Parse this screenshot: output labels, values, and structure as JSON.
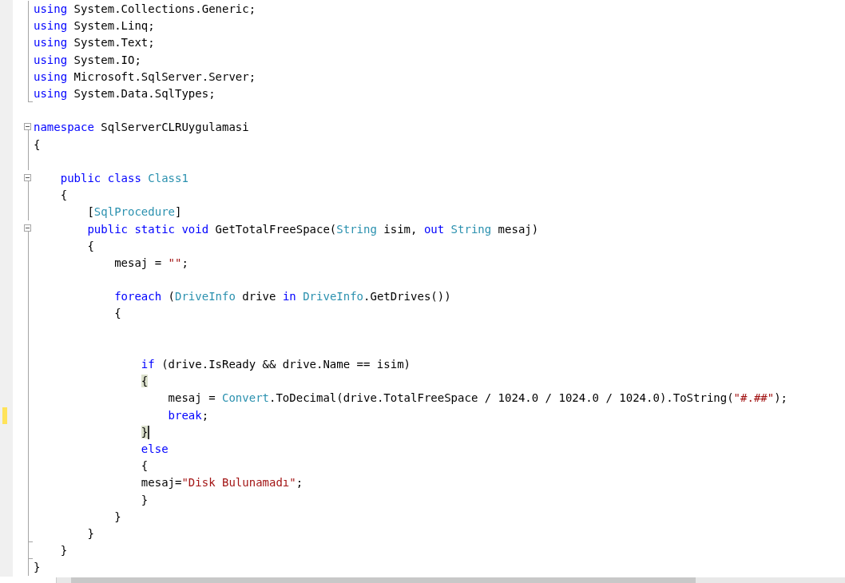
{
  "editor": {
    "lines": [
      {
        "outlined": true,
        "collapsible": false,
        "block_end": false,
        "changed": false,
        "tokens": [
          {
            "kind": "keyword",
            "text": "using"
          },
          {
            "kind": "plain",
            "text": " System.Collections.Generic;"
          }
        ]
      },
      {
        "outlined": true,
        "collapsible": false,
        "block_end": false,
        "changed": false,
        "tokens": [
          {
            "kind": "keyword",
            "text": "using"
          },
          {
            "kind": "plain",
            "text": " System.Linq;"
          }
        ]
      },
      {
        "outlined": true,
        "collapsible": false,
        "block_end": false,
        "changed": false,
        "tokens": [
          {
            "kind": "keyword",
            "text": "using"
          },
          {
            "kind": "plain",
            "text": " System.Text;"
          }
        ]
      },
      {
        "outlined": true,
        "collapsible": false,
        "block_end": false,
        "changed": false,
        "tokens": [
          {
            "kind": "keyword",
            "text": "using"
          },
          {
            "kind": "plain",
            "text": " System.IO;"
          }
        ]
      },
      {
        "outlined": true,
        "collapsible": false,
        "block_end": false,
        "changed": false,
        "tokens": [
          {
            "kind": "keyword",
            "text": "using"
          },
          {
            "kind": "plain",
            "text": " Microsoft.SqlServer.Server;"
          }
        ]
      },
      {
        "outlined": true,
        "collapsible": false,
        "block_end": true,
        "changed": false,
        "tokens": [
          {
            "kind": "keyword",
            "text": "using"
          },
          {
            "kind": "plain",
            "text": " System.Data.SqlTypes;"
          }
        ]
      },
      {
        "outlined": false,
        "collapsible": false,
        "block_end": false,
        "changed": false
      },
      {
        "outlined": true,
        "collapsible": true,
        "block_end": false,
        "changed": false,
        "tokens": [
          {
            "kind": "keyword",
            "text": "namespace"
          },
          {
            "kind": "plain",
            "text": " SqlServerCLRUygulamasi"
          }
        ]
      },
      {
        "outlined": true,
        "collapsible": false,
        "block_end": false,
        "changed": false,
        "tokens": [
          {
            "kind": "plain",
            "text": "{"
          }
        ]
      },
      {
        "outlined": true,
        "collapsible": false,
        "block_end": false,
        "changed": false
      },
      {
        "outlined": true,
        "collapsible": true,
        "block_end": false,
        "changed": false,
        "tokens": [
          {
            "kind": "keyword",
            "text": "    public class "
          },
          {
            "kind": "type",
            "text": "Class1"
          }
        ]
      },
      {
        "outlined": true,
        "collapsible": false,
        "block_end": false,
        "changed": false,
        "tokens": [
          {
            "kind": "plain",
            "text": "    {"
          }
        ]
      },
      {
        "outlined": true,
        "collapsible": false,
        "block_end": false,
        "changed": false,
        "tokens": [
          {
            "kind": "plain",
            "text": "        ["
          },
          {
            "kind": "type",
            "text": "SqlProcedure"
          },
          {
            "kind": "plain",
            "text": "]"
          }
        ]
      },
      {
        "outlined": true,
        "collapsible": true,
        "block_end": false,
        "changed": false,
        "tokens": [
          {
            "kind": "keyword",
            "text": "        public static void"
          },
          {
            "kind": "plain",
            "text": " GetTotalFreeSpace("
          },
          {
            "kind": "type",
            "text": "String"
          },
          {
            "kind": "plain",
            "text": " isim, "
          },
          {
            "kind": "keyword",
            "text": "out "
          },
          {
            "kind": "type",
            "text": "String"
          },
          {
            "kind": "plain",
            "text": " mesaj)"
          }
        ]
      },
      {
        "outlined": true,
        "collapsible": false,
        "block_end": false,
        "changed": false,
        "tokens": [
          {
            "kind": "plain",
            "text": "        {"
          }
        ]
      },
      {
        "outlined": true,
        "collapsible": false,
        "block_end": false,
        "changed": false,
        "tokens": [
          {
            "kind": "plain",
            "text": "            mesaj = "
          },
          {
            "kind": "string",
            "text": "\"\""
          },
          {
            "kind": "plain",
            "text": ";"
          }
        ]
      },
      {
        "outlined": true,
        "collapsible": false,
        "block_end": false,
        "changed": false
      },
      {
        "outlined": true,
        "collapsible": false,
        "block_end": false,
        "changed": false,
        "tokens": [
          {
            "kind": "keyword",
            "text": "            foreach"
          },
          {
            "kind": "plain",
            "text": " ("
          },
          {
            "kind": "type",
            "text": "DriveInfo"
          },
          {
            "kind": "plain",
            "text": " drive "
          },
          {
            "kind": "keyword",
            "text": "in "
          },
          {
            "kind": "type",
            "text": "DriveInfo"
          },
          {
            "kind": "plain",
            "text": ".GetDrives())"
          }
        ]
      },
      {
        "outlined": true,
        "collapsible": false,
        "block_end": false,
        "changed": false,
        "tokens": [
          {
            "kind": "plain",
            "text": "            {"
          }
        ]
      },
      {
        "outlined": true,
        "collapsible": false,
        "block_end": false,
        "changed": false
      },
      {
        "outlined": true,
        "collapsible": false,
        "block_end": false,
        "changed": false
      },
      {
        "outlined": true,
        "collapsible": false,
        "block_end": false,
        "changed": false,
        "tokens": [
          {
            "kind": "keyword",
            "text": "                if"
          },
          {
            "kind": "plain",
            "text": " (drive.IsReady && drive.Name == isim)"
          }
        ]
      },
      {
        "outlined": true,
        "collapsible": false,
        "block_end": false,
        "changed": false,
        "tokens": [
          {
            "kind": "plain",
            "text": "                {",
            "highlighted": true
          }
        ]
      },
      {
        "outlined": true,
        "collapsible": false,
        "block_end": false,
        "changed": false,
        "tokens": [
          {
            "kind": "plain",
            "text": "                    mesaj = "
          },
          {
            "kind": "type",
            "text": "Convert"
          },
          {
            "kind": "plain",
            "text": ".ToDecimal(drive.TotalFreeSpace / 1024.0 / 1024.0 / 1024.0).ToString("
          },
          {
            "kind": "string",
            "text": "\"#.##\""
          },
          {
            "kind": "plain",
            "text": ");"
          }
        ]
      },
      {
        "outlined": true,
        "collapsible": false,
        "block_end": false,
        "changed": true,
        "tokens": [
          {
            "kind": "keyword",
            "text": "                    break"
          },
          {
            "kind": "plain",
            "text": ";"
          }
        ]
      },
      {
        "outlined": true,
        "collapsible": false,
        "block_end": false,
        "changed": false,
        "caret": true,
        "tokens": [
          {
            "kind": "plain",
            "text": "                }",
            "highlighted": true
          }
        ]
      },
      {
        "outlined": true,
        "collapsible": false,
        "block_end": false,
        "changed": false,
        "tokens": [
          {
            "kind": "keyword",
            "text": "                else"
          }
        ]
      },
      {
        "outlined": true,
        "collapsible": false,
        "block_end": false,
        "changed": false,
        "tokens": [
          {
            "kind": "plain",
            "text": "                {"
          }
        ]
      },
      {
        "outlined": true,
        "collapsible": false,
        "block_end": false,
        "changed": false,
        "tokens": [
          {
            "kind": "plain",
            "text": "                mesaj="
          },
          {
            "kind": "string",
            "text": "\"Disk Bulunamadı\""
          },
          {
            "kind": "plain",
            "text": ";"
          }
        ]
      },
      {
        "outlined": true,
        "collapsible": false,
        "block_end": false,
        "changed": false,
        "tokens": [
          {
            "kind": "plain",
            "text": "                }"
          }
        ]
      },
      {
        "outlined": true,
        "collapsible": false,
        "block_end": false,
        "changed": false,
        "tokens": [
          {
            "kind": "plain",
            "text": "            }"
          }
        ]
      },
      {
        "outlined": true,
        "collapsible": false,
        "block_end": true,
        "changed": false,
        "tokens": [
          {
            "kind": "plain",
            "text": "        }"
          }
        ]
      },
      {
        "outlined": true,
        "collapsible": false,
        "block_end": true,
        "changed": false,
        "tokens": [
          {
            "kind": "plain",
            "text": "    }"
          }
        ]
      },
      {
        "outlined": true,
        "collapsible": false,
        "block_end": false,
        "changed": false,
        "tokens": [
          {
            "kind": "plain",
            "text": "}"
          }
        ]
      }
    ]
  }
}
